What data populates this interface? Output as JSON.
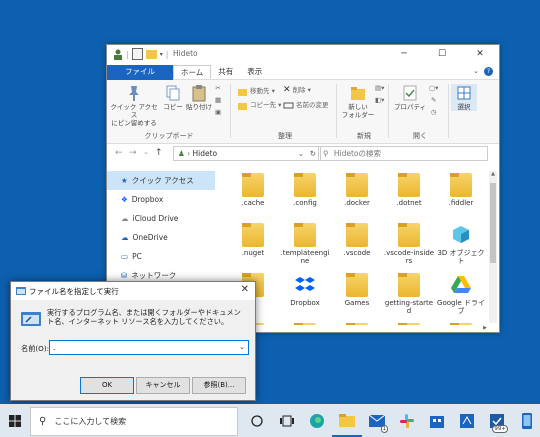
{
  "explorer": {
    "title": "Hideto",
    "window_buttons": [
      "─",
      "☐",
      "✕"
    ],
    "tabs": [
      "ファイル",
      "ホーム",
      "共有",
      "表示"
    ],
    "ribbon": {
      "clipboard": {
        "pin": "クイック アクセス\nにピン留めする",
        "copy": "コピー",
        "paste": "貼り付け",
        "label": "クリップボード"
      },
      "organize": {
        "move": "移動先 ▾",
        "copy_to": "コピー先 ▾",
        "delete": "削除 ▾",
        "rename": "名前の変更",
        "label": "整理"
      },
      "new": {
        "new_folder": "新しい\nフォルダー",
        "label": "新規"
      },
      "open": {
        "properties": "プロパティ",
        "label": "開く"
      },
      "select": {
        "select": "選択"
      }
    },
    "address": {
      "path": "Hideto",
      "search_placeholder": "Hidetoの検索"
    },
    "nav": [
      {
        "label": "クイック アクセス",
        "icon": "star-icon",
        "selected": true
      },
      {
        "label": "Dropbox",
        "icon": "dropbox-icon"
      },
      {
        "label": "iCloud Drive",
        "icon": "icloud-icon"
      },
      {
        "label": "OneDrive",
        "icon": "cloud-icon"
      },
      {
        "label": "PC",
        "icon": "pc-icon"
      },
      {
        "label": "ネットワーク",
        "icon": "network-icon"
      }
    ],
    "files": [
      {
        "name": ".cache",
        "type": "folder"
      },
      {
        "name": ".config",
        "type": "folder"
      },
      {
        "name": ".docker",
        "type": "folder"
      },
      {
        "name": ".dotnet",
        "type": "folder"
      },
      {
        "name": ".fiddler",
        "type": "folder"
      },
      {
        "name": ".nuget",
        "type": "folder"
      },
      {
        "name": ".templateengine",
        "type": "folder"
      },
      {
        "name": ".vscode",
        "type": "folder"
      },
      {
        "name": ".vscode-insiders",
        "type": "folder"
      },
      {
        "name": "3D オブジェクト",
        "type": "3d"
      },
      {
        "name": "",
        "type": "folder"
      },
      {
        "name": "Dropbox",
        "type": "dropbox"
      },
      {
        "name": "Games",
        "type": "folder"
      },
      {
        "name": "getting-started",
        "type": "folder"
      },
      {
        "name": "Google ドライブ",
        "type": "gdrive"
      },
      {
        "name": "",
        "type": "folder"
      },
      {
        "name": "",
        "type": "folder"
      },
      {
        "name": "",
        "type": "folder"
      },
      {
        "name": "",
        "type": "folder"
      },
      {
        "name": "",
        "type": "folder"
      }
    ]
  },
  "run_dialog": {
    "title": "ファイル名を指定して実行",
    "description": "実行するプログラム名、または開くフォルダーやドキュメント名、インターネット リソース名を入力してください。",
    "name_label": "名前(O):",
    "name_value": ".",
    "ok": "OK",
    "cancel": "キャンセル",
    "browse": "参照(B)..."
  },
  "taskbar": {
    "search_placeholder": "ここに入力して検索",
    "icons": [
      "cortana-icon",
      "task-view-icon",
      "edge-icon",
      "explorer-icon",
      "mail-icon",
      "slack-icon",
      "store-icon",
      "azure-icon",
      "todo-icon",
      "phone-icon"
    ],
    "mail_badge": "1",
    "todo_badge": "99+"
  },
  "colors": {
    "accent": "#1a65c0",
    "desktop": "#0d60b0",
    "taskbar": "#dfe7f0",
    "folder": "#f3c647"
  }
}
